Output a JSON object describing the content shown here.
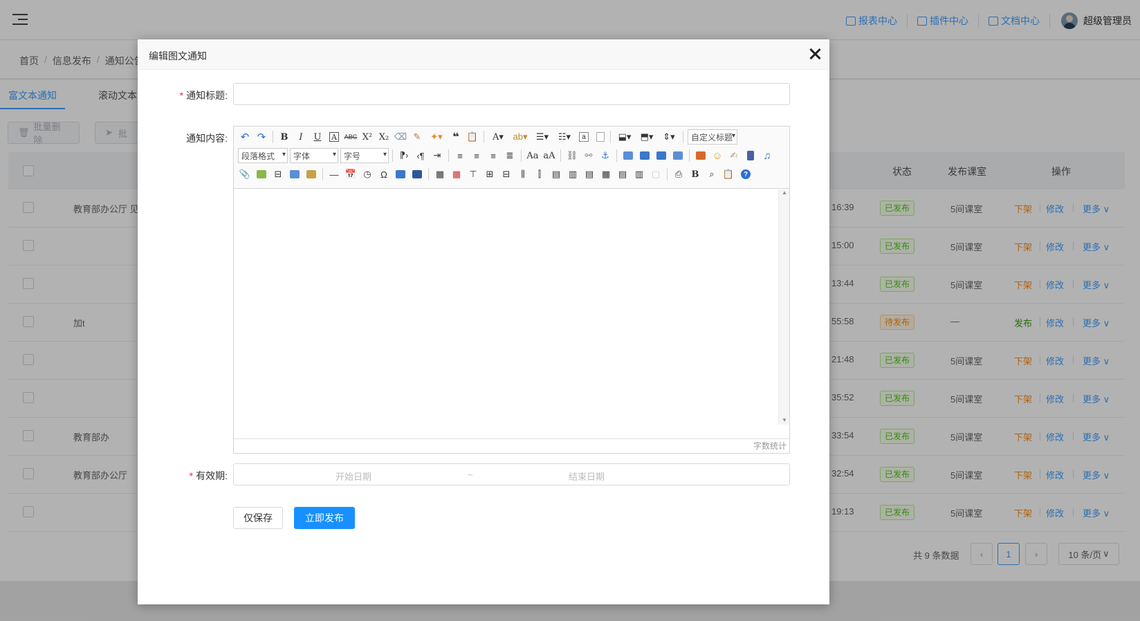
{
  "header": {
    "links": [
      {
        "label": "报表中心",
        "icon": "report-icon"
      },
      {
        "label": "插件中心",
        "icon": "plugin-icon"
      },
      {
        "label": "文档中心",
        "icon": "document-icon"
      }
    ],
    "user": "超级管理员"
  },
  "breadcrumb": [
    "首页",
    "信息发布",
    "通知公告"
  ],
  "tabs": [
    "富文本通知",
    "滚动文本"
  ],
  "actions": {
    "batch_delete": "批量删除",
    "batch_other": "批"
  },
  "table": {
    "headers": {
      "status": "状态",
      "classroom": "发布课室",
      "ops": "操作"
    },
    "rows": [
      {
        "title": "教育部办公厅 见",
        "time": "16:39",
        "status": "已发布",
        "status_type": "pub",
        "classroom": "5间课室",
        "op1": "下架"
      },
      {
        "title": "",
        "time": "15:00",
        "status": "已发布",
        "status_type": "pub",
        "classroom": "5间课室",
        "op1": "下架"
      },
      {
        "title": "",
        "time": "13:44",
        "status": "已发布",
        "status_type": "pub",
        "classroom": "5间课室",
        "op1": "下架"
      },
      {
        "title": "加t",
        "time": "55:58",
        "status": "待发布",
        "status_type": "wait",
        "classroom": "—",
        "op1": "发布"
      },
      {
        "title": "",
        "time": "21:48",
        "status": "已发布",
        "status_type": "pub",
        "classroom": "5间课室",
        "op1": "下架"
      },
      {
        "title": "",
        "time": "35:52",
        "status": "已发布",
        "status_type": "pub",
        "classroom": "5间课室",
        "op1": "下架"
      },
      {
        "title": "教育部办",
        "time": "33:54",
        "status": "已发布",
        "status_type": "pub",
        "classroom": "5间课室",
        "op1": "下架"
      },
      {
        "title": "教育部办公厅",
        "time": "32:54",
        "status": "已发布",
        "status_type": "pub",
        "classroom": "5间课室",
        "op1": "下架"
      },
      {
        "title": "",
        "time": "19:13",
        "status": "已发布",
        "status_type": "pub",
        "classroom": "5间课室",
        "op1": "下架"
      }
    ],
    "op_edit": "修改",
    "op_more": "更多"
  },
  "pagination": {
    "total_text": "共 9 条数据",
    "current_page": "1",
    "page_size": "10 条/页"
  },
  "modal": {
    "title": "编辑图文通知",
    "title_label": "通知标题:",
    "content_label": "通知内容:",
    "validity_label": "有效期:",
    "editor": {
      "paragraph_format": "段落格式",
      "font_family": "字体",
      "font_size": "字号",
      "custom_heading": "自定义标题",
      "word_count": "字数统计"
    },
    "start_date_placeholder": "开始日期",
    "date_separator": "~",
    "end_date_placeholder": "结束日期",
    "save_only": "仅保存",
    "publish_now": "立即发布"
  },
  "colors": {
    "primary": "#1890ff",
    "published": "#52c41a",
    "pending": "#fa8c16",
    "required": "#f5222d"
  }
}
